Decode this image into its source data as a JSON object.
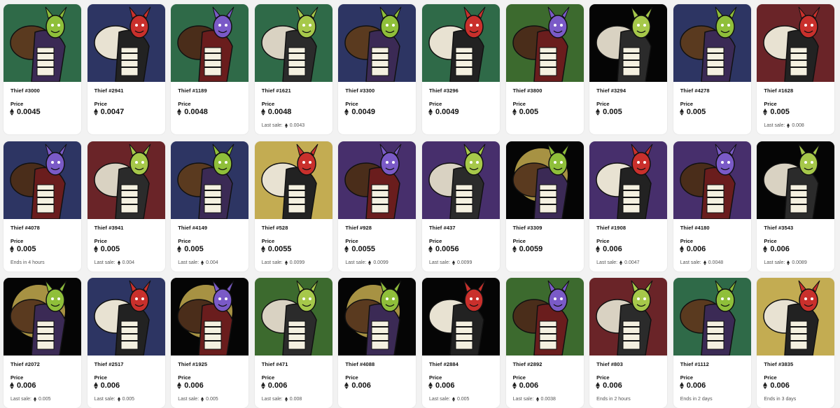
{
  "labels": {
    "price": "Price",
    "last_sale": "Last sale:"
  },
  "colors": {
    "green": "#2f6a48",
    "navy": "#2d3563",
    "maroon": "#6a2428",
    "gold": "#c3ac52",
    "purple": "#472f6c",
    "black": "#050505",
    "olive": "#3c6a2e",
    "moon": "#b9a24a"
  },
  "cards": [
    {
      "name": "Thief #3000",
      "price": "0.0045",
      "bg": "green",
      "footer": "",
      "last": ""
    },
    {
      "name": "Thief #2941",
      "price": "0.0047",
      "bg": "navy",
      "footer": "",
      "last": ""
    },
    {
      "name": "Thief #1189",
      "price": "0.0048",
      "bg": "green",
      "footer": "",
      "last": ""
    },
    {
      "name": "Thief #1621",
      "price": "0.0048",
      "bg": "green",
      "footer": "last",
      "last": "0.0043"
    },
    {
      "name": "Thief #3300",
      "price": "0.0049",
      "bg": "navy",
      "footer": "",
      "last": ""
    },
    {
      "name": "Thief #3296",
      "price": "0.0049",
      "bg": "green",
      "footer": "",
      "last": ""
    },
    {
      "name": "Thief #3800",
      "price": "0.005",
      "bg": "olive",
      "footer": "",
      "last": ""
    },
    {
      "name": "Thief #3294",
      "price": "0.005",
      "bg": "black",
      "footer": "",
      "last": ""
    },
    {
      "name": "Thief #4278",
      "price": "0.005",
      "bg": "navy",
      "footer": "",
      "last": ""
    },
    {
      "name": "Thief #1628",
      "price": "0.005",
      "bg": "maroon",
      "footer": "last",
      "last": "0.008"
    },
    {
      "name": "Thief #4078",
      "price": "0.005",
      "bg": "navy",
      "footer": "text",
      "text": "Ends in 4 hours",
      "last": ""
    },
    {
      "name": "Thief #3941",
      "price": "0.005",
      "bg": "maroon",
      "footer": "last",
      "last": "0.004"
    },
    {
      "name": "Thief #4149",
      "price": "0.005",
      "bg": "navy",
      "footer": "last",
      "last": "0.004"
    },
    {
      "name": "Thief #528",
      "price": "0.0055",
      "bg": "gold",
      "footer": "last",
      "last": "0.0099"
    },
    {
      "name": "Thief #928",
      "price": "0.0055",
      "bg": "purple",
      "footer": "last",
      "last": "0.0099"
    },
    {
      "name": "Thief #437",
      "price": "0.0056",
      "bg": "purple",
      "footer": "last",
      "last": "0.0099"
    },
    {
      "name": "Thief #3309",
      "price": "0.0059",
      "bg": "black",
      "footer": "",
      "last": ""
    },
    {
      "name": "Thief #1908",
      "price": "0.006",
      "bg": "purple",
      "footer": "last",
      "last": "0.0047"
    },
    {
      "name": "Thief #4180",
      "price": "0.006",
      "bg": "purple",
      "footer": "last",
      "last": "0.0048"
    },
    {
      "name": "Thief #3543",
      "price": "0.006",
      "bg": "black",
      "footer": "last",
      "last": "0.0089"
    },
    {
      "name": "Thief #2072",
      "price": "0.006",
      "bg": "black",
      "footer": "last",
      "last": "0.005"
    },
    {
      "name": "Thief #2517",
      "price": "0.006",
      "bg": "navy",
      "footer": "last",
      "last": "0.005"
    },
    {
      "name": "Thief #1925",
      "price": "0.006",
      "bg": "black",
      "footer": "last",
      "last": "0.005"
    },
    {
      "name": "Thief #471",
      "price": "0.006",
      "bg": "olive",
      "footer": "last",
      "last": "0.008"
    },
    {
      "name": "Thief #4088",
      "price": "0.006",
      "bg": "black",
      "footer": "",
      "last": ""
    },
    {
      "name": "Thief #2884",
      "price": "0.006",
      "bg": "black",
      "footer": "last",
      "last": "0.005"
    },
    {
      "name": "Thief #2892",
      "price": "0.006",
      "bg": "olive",
      "footer": "last",
      "last": "0.0038"
    },
    {
      "name": "Thief #803",
      "price": "0.006",
      "bg": "maroon",
      "footer": "text",
      "text": "Ends in 2 hours",
      "last": ""
    },
    {
      "name": "Thief #1112",
      "price": "0.006",
      "bg": "green",
      "footer": "text",
      "text": "Ends in 2 days",
      "last": ""
    },
    {
      "name": "Thief #3835",
      "price": "0.006",
      "bg": "gold",
      "footer": "text",
      "text": "Ends in 3 days",
      "last": ""
    }
  ]
}
